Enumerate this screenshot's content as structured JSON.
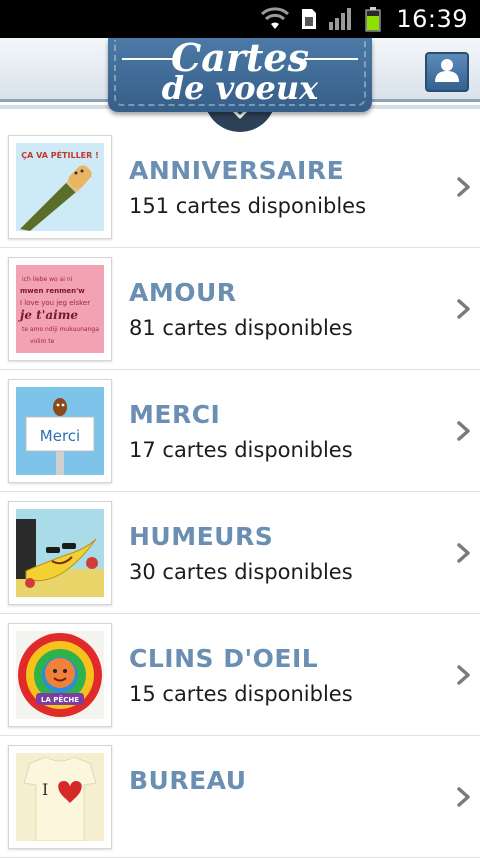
{
  "status_bar": {
    "time": "16:39",
    "icons": [
      "wifi-icon",
      "sim-card-icon",
      "signal-icon",
      "battery-icon"
    ]
  },
  "header": {
    "logo_line1": "Cartes",
    "logo_line2": "de voeux",
    "icons": [
      "chevron-down-icon",
      "profile-icon"
    ],
    "colors": {
      "brand_blue": "#4c7aa6",
      "dark_tab": "#2d4257",
      "title_blue": "#6b8fb2"
    }
  },
  "categories": [
    {
      "title": "ANNIVERSAIRE",
      "count_text": "151 cartes disponibles",
      "thumb_text": "ÇA VA PÉTILLER !"
    },
    {
      "title": "AMOUR",
      "count_text": "81 cartes disponibles",
      "thumb_text": "je t'aime"
    },
    {
      "title": "MERCI",
      "count_text": "17 cartes disponibles",
      "thumb_text": "Merci"
    },
    {
      "title": "HUMEURS",
      "count_text": "30 cartes disponibles",
      "thumb_text": ""
    },
    {
      "title": "CLINS D'OEIL",
      "count_text": "15 cartes disponibles",
      "thumb_text": "LA PÊCHE"
    },
    {
      "title": "BUREAU",
      "count_text": "",
      "thumb_text": "I"
    }
  ]
}
